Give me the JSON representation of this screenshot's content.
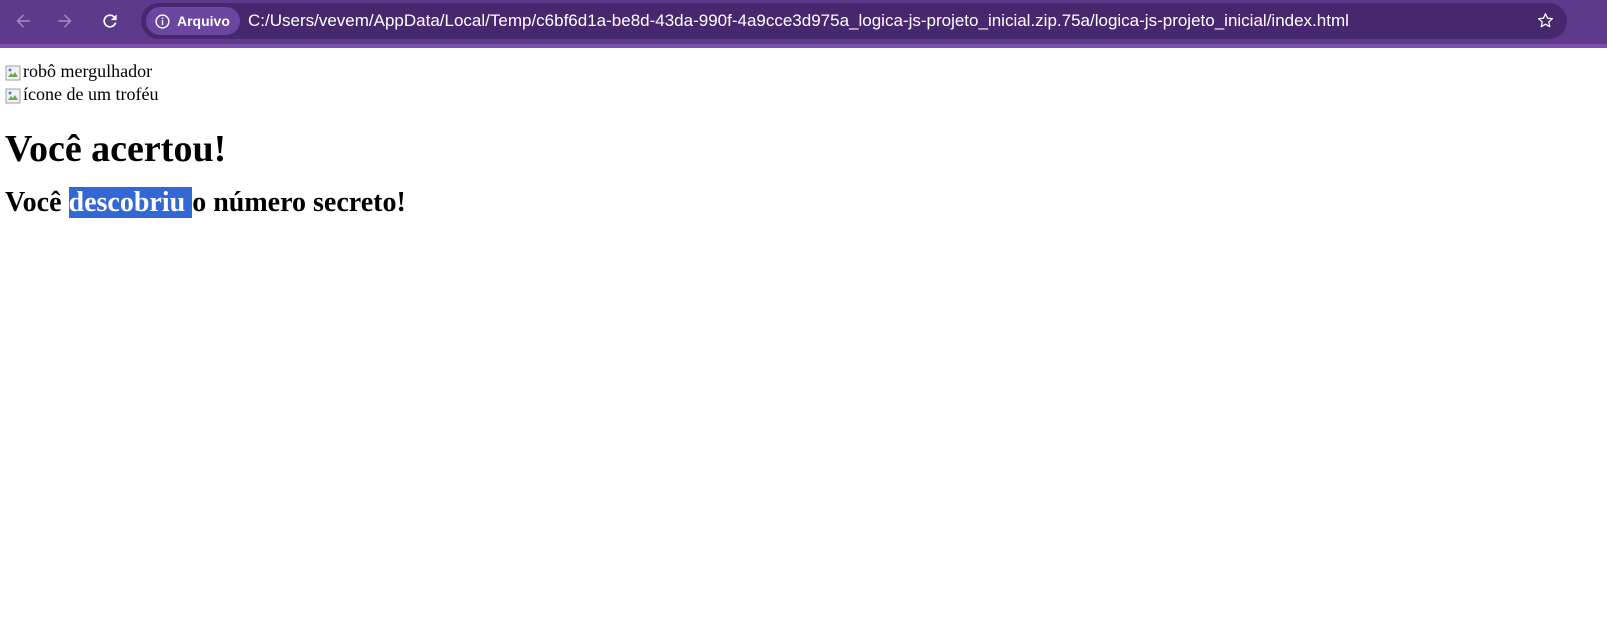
{
  "browser": {
    "security_chip_label": "Arquivo",
    "url": "C:/Users/vevem/AppData/Local/Temp/c6bf6d1a-be8d-43da-990f-4a9cce3d975a_logica-js-projeto_inicial.zip.75a/logica-js-projeto_inicial/index.html",
    "icons": [
      "back-arrow-icon",
      "forward-arrow-icon",
      "reload-icon",
      "info-icon",
      "star-icon"
    ],
    "colors": {
      "toolbar": "#5d3a8c",
      "omnibox": "#47286e",
      "chip": "#6a46a0",
      "selection": "#3367d6"
    }
  },
  "page": {
    "images": [
      {
        "alt": "robô mergulhador"
      },
      {
        "alt": "ícone de um troféu"
      }
    ],
    "title": "Você acertou!",
    "subtitle": {
      "before": "Você ",
      "selected": "descobriu ",
      "after": "o número secreto!"
    }
  }
}
